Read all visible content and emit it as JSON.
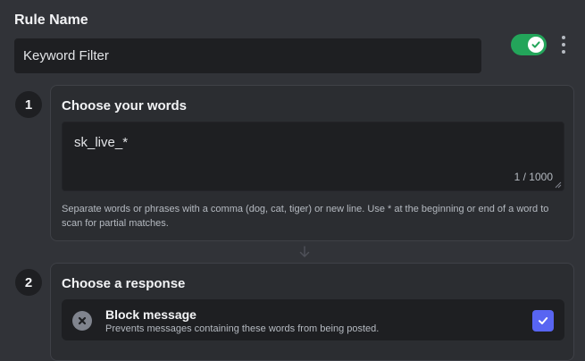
{
  "rule": {
    "name_label": "Rule Name",
    "name_value": "Keyword Filter",
    "enabled": true,
    "toggle_color": "#23a55a"
  },
  "steps": [
    {
      "number": "1",
      "title": "Choose your words",
      "words_value": "sk_live_*",
      "char_count": "1 / 1000",
      "help_text": "Separate words or phrases with a comma (dog, cat, tiger) or new line. Use * at the beginning or end of a word to scan for partial matches."
    },
    {
      "number": "2",
      "title": "Choose a response",
      "options": [
        {
          "title": "Block message",
          "description": "Prevents messages containing these words from being posted.",
          "icon": "block-x-icon",
          "checked": true
        }
      ]
    }
  ],
  "colors": {
    "accent": "#5865f2",
    "background": "#313338",
    "input_bg": "#1e1f22"
  }
}
